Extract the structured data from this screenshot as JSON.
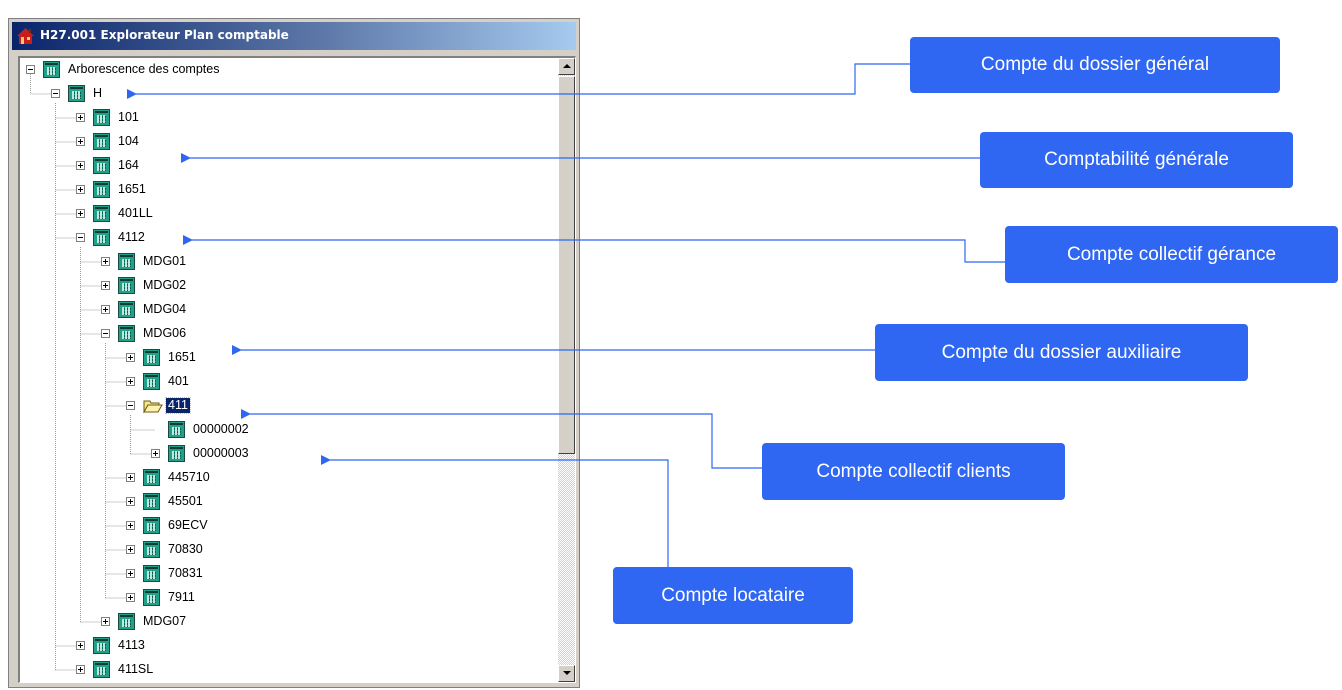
{
  "window": {
    "title": "H27.001   Explorateur Plan comptable",
    "app_icon": "house-icon"
  },
  "tree": {
    "root": "Arborescence des comptes",
    "nodes": [
      {
        "label": "H",
        "state": "expanded",
        "icon": "account-icon"
      },
      {
        "label": "101",
        "state": "collapsed",
        "icon": "account-icon"
      },
      {
        "label": "104",
        "state": "collapsed",
        "icon": "account-icon"
      },
      {
        "label": "164",
        "state": "collapsed",
        "icon": "account-icon"
      },
      {
        "label": "1651",
        "state": "collapsed",
        "icon": "account-icon"
      },
      {
        "label": "401LL",
        "state": "collapsed",
        "icon": "account-icon"
      },
      {
        "label": "4112",
        "state": "expanded",
        "icon": "account-icon"
      },
      {
        "label": "MDG01",
        "state": "collapsed",
        "icon": "account-icon"
      },
      {
        "label": "MDG02",
        "state": "collapsed",
        "icon": "account-icon"
      },
      {
        "label": "MDG04",
        "state": "collapsed",
        "icon": "account-icon"
      },
      {
        "label": "MDG06",
        "state": "expanded",
        "icon": "account-icon"
      },
      {
        "label": "1651",
        "state": "collapsed",
        "icon": "account-icon"
      },
      {
        "label": "401",
        "state": "collapsed",
        "icon": "account-icon"
      },
      {
        "label": "411",
        "state": "expanded",
        "icon": "open-folder-icon",
        "selected": true
      },
      {
        "label": "00000002",
        "state": "leaf",
        "icon": "account-icon"
      },
      {
        "label": "00000003",
        "state": "collapsed",
        "icon": "account-icon"
      },
      {
        "label": "445710",
        "state": "collapsed",
        "icon": "account-icon"
      },
      {
        "label": "45501",
        "state": "collapsed",
        "icon": "account-icon"
      },
      {
        "label": "69ECV",
        "state": "collapsed",
        "icon": "account-icon"
      },
      {
        "label": "70830",
        "state": "collapsed",
        "icon": "account-icon"
      },
      {
        "label": "70831",
        "state": "collapsed",
        "icon": "account-icon"
      },
      {
        "label": "7911",
        "state": "collapsed",
        "icon": "account-icon"
      },
      {
        "label": "MDG07",
        "state": "collapsed",
        "icon": "account-icon"
      },
      {
        "label": "4113",
        "state": "collapsed",
        "icon": "account-icon"
      },
      {
        "label": "411SL",
        "state": "collapsed",
        "icon": "account-icon"
      }
    ]
  },
  "callouts": [
    {
      "text": "Compte du dossier général"
    },
    {
      "text": "Comptabilité générale"
    },
    {
      "text": "Compte collectif gérance"
    },
    {
      "text": "Compte du dossier auxiliaire"
    },
    {
      "text": "Compte collectif clients"
    },
    {
      "text": "Compte locataire"
    }
  ],
  "colors": {
    "callout_bg": "#2f66f2",
    "arrow": "#2f66f2",
    "selection": "#0a246a",
    "titlebar": "#0a246a"
  }
}
